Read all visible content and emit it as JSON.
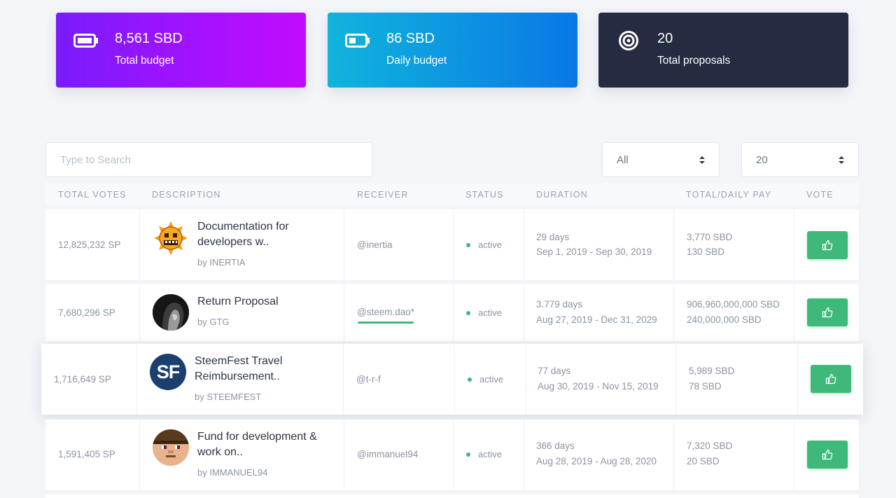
{
  "stats": {
    "total_budget": {
      "value": "8,561 SBD",
      "label": "Total budget",
      "icon": "battery-full-icon"
    },
    "daily_budget": {
      "value": "86 SBD",
      "label": "Daily budget",
      "icon": "battery-half-icon"
    },
    "total_proposals": {
      "value": "20",
      "label": "Total proposals",
      "icon": "target-icon"
    }
  },
  "filters": {
    "search_placeholder": "Type to Search",
    "status_select": "All",
    "page_size_select": "20"
  },
  "table": {
    "headers": {
      "total_votes": "TOTAL VOTES",
      "description": "DESCRIPTION",
      "receiver": "RECEIVER",
      "status": "STATUS",
      "duration": "DURATION",
      "pay": "TOTAL/DAILY PAY",
      "vote": "VOTE"
    },
    "rows": [
      {
        "votes": "12,825,232 SP",
        "title_line1": "Documentation for",
        "title_line2": "developers w..",
        "author": "by INERTIA",
        "receiver": "@inertia",
        "status": "active",
        "days": "29 days",
        "range": "Sep 1, 2019 - Sep 30, 2019",
        "total_pay": "3,770 SBD",
        "daily_pay": "130 SBD"
      },
      {
        "votes": "7,680,296 SP",
        "title_line1": "Return Proposal",
        "title_line2": "",
        "author": "by GTG",
        "receiver": "@steem.dao*",
        "status": "active",
        "days": "3.779 days",
        "range": "Aug 27, 2019 - Dec 31, 2029",
        "total_pay": "906,960,000,000 SBD",
        "daily_pay": "240,000,000 SBD"
      },
      {
        "votes": "1,716,649 SP",
        "title_line1": "SteemFest Travel",
        "title_line2": "Reimbursement..",
        "author": "by STEEMFEST",
        "receiver": "@t-r-f",
        "status": "active",
        "days": "77 days",
        "range": "Aug 30, 2019 - Nov 15, 2019",
        "total_pay": "5,989 SBD",
        "daily_pay": "78 SBD",
        "avatar_text": "SF"
      },
      {
        "votes": "1,591,405 SP",
        "title_line1": "Fund for development &",
        "title_line2": "work on..",
        "author": "by IMMANUEL94",
        "receiver": "@immanuel94",
        "status": "active",
        "days": "366 days",
        "range": "Aug 28, 2019 - Aug 28, 2020",
        "total_pay": "7,320 SBD",
        "daily_pay": "20 SBD"
      }
    ]
  },
  "colors": {
    "accent_green": "#3fb97a",
    "card_purple": "#8a16fd",
    "card_blue": "#0a96e0",
    "card_dark": "#252c41"
  }
}
